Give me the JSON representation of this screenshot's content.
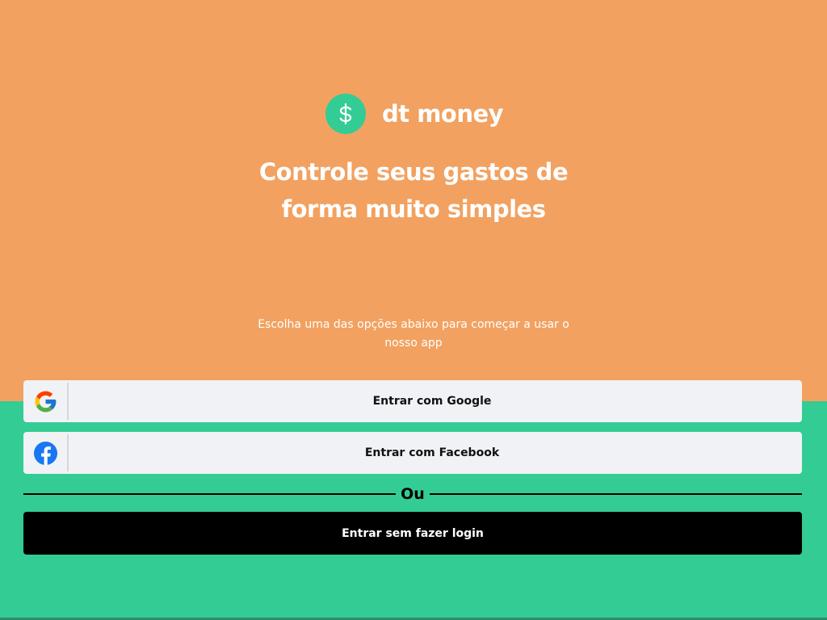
{
  "colors": {
    "top_background": "#f2a160",
    "bottom_background": "#33cc95",
    "button_background": "#f0f2f5",
    "guest_button_background": "#000000",
    "text_light": "#ffffff",
    "text_dark": "#111111"
  },
  "brand": {
    "name": "dt money",
    "logo_icon": "dollar-sign-icon"
  },
  "hero": {
    "title_line1": "Controle seus gastos de",
    "title_line2": "forma muito simples"
  },
  "intro": {
    "text": "Escolha uma das opções abaixo para começar a usar o nosso app"
  },
  "auth": {
    "google_label": "Entrar com Google",
    "google_icon": "google-icon",
    "facebook_label": "Entrar com Facebook",
    "facebook_icon": "facebook-icon",
    "divider_text": "Ou",
    "guest_label": "Entrar sem fazer login"
  }
}
